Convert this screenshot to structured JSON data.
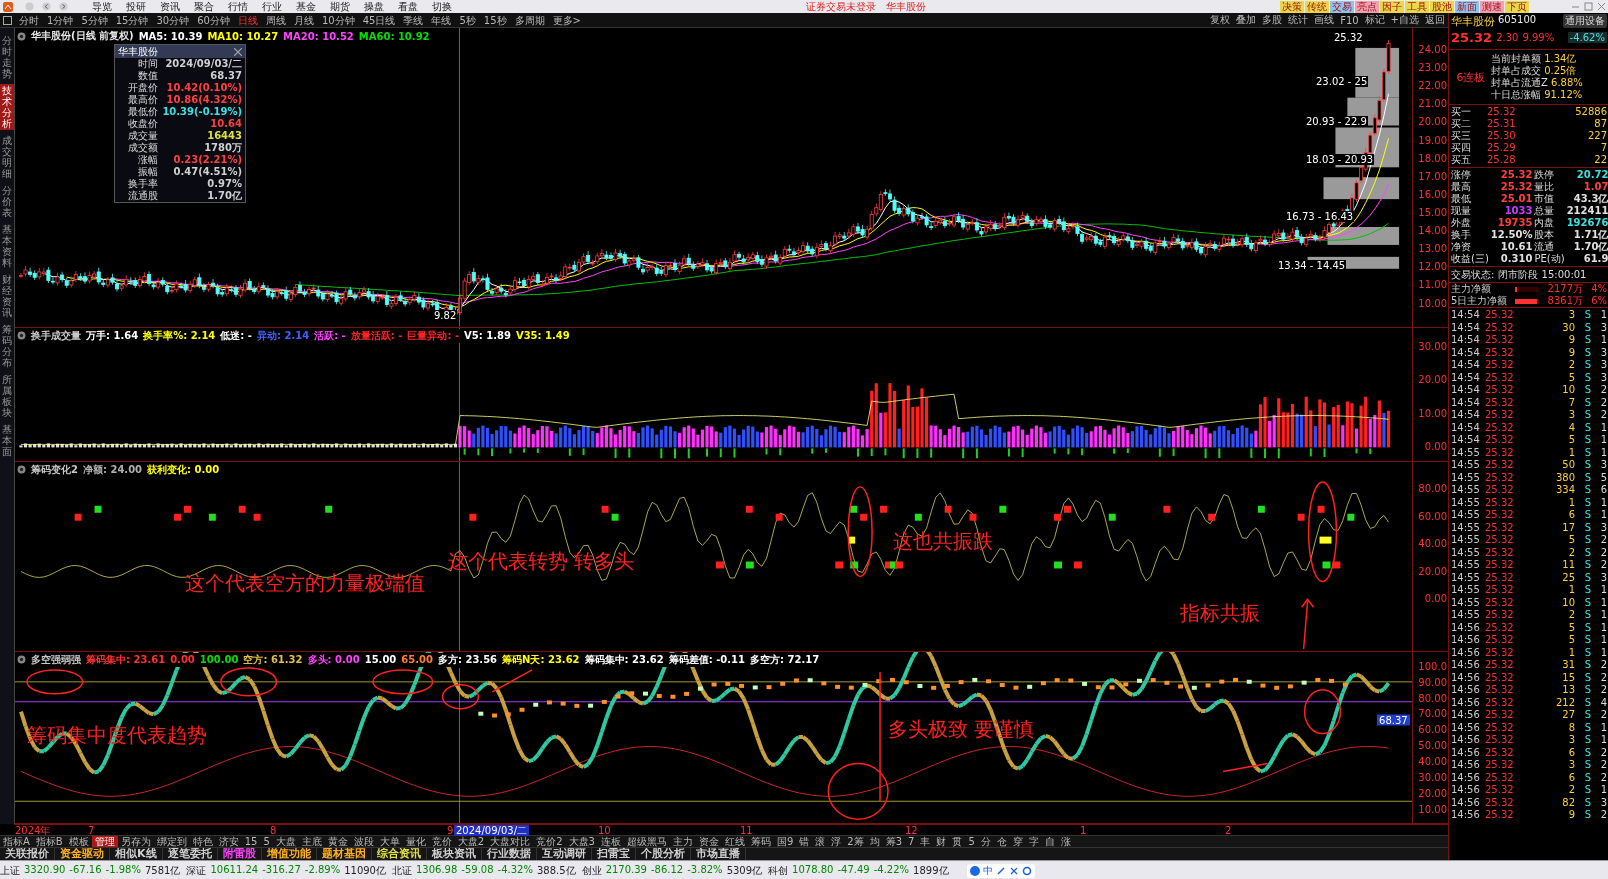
{
  "menu": [
    "导览",
    "投研",
    "资讯",
    "聚合",
    "行情",
    "行业",
    "基金",
    "期货",
    "操盘",
    "看盘",
    "切换"
  ],
  "login_notice": "证券交易未登录",
  "window_stock": "华丰股份",
  "top_buttons": [
    {
      "label": "决策",
      "color": "#e8d84a"
    },
    {
      "label": "传统",
      "color": "#e8d84a"
    },
    {
      "label": "交易",
      "color": "#8fc3f0"
    },
    {
      "label": "亮点",
      "color": "#f0a0b0"
    },
    {
      "label": "因子",
      "color": "#e8d84a"
    },
    {
      "label": "工具",
      "color": "#e8d84a"
    },
    {
      "label": "股池",
      "color": "#e8d84a"
    },
    {
      "label": "新面",
      "color": "#8fc3f0"
    },
    {
      "label": "测速",
      "color": "#f0a0b0"
    },
    {
      "label": "下页",
      "color": "#e8d84a"
    }
  ],
  "periods": [
    {
      "label": "分时",
      "selected": false
    },
    {
      "label": "1分钟",
      "selected": false
    },
    {
      "label": "5分钟",
      "selected": false
    },
    {
      "label": "15分钟",
      "selected": false
    },
    {
      "label": "30分钟",
      "selected": false
    },
    {
      "label": "60分钟",
      "selected": false
    },
    {
      "label": "日线",
      "selected": true
    },
    {
      "label": "周线",
      "selected": false
    },
    {
      "label": "月线",
      "selected": false
    },
    {
      "label": "10分钟",
      "selected": false
    },
    {
      "label": "45日线",
      "selected": false
    },
    {
      "label": "季线",
      "selected": false
    },
    {
      "label": "年线",
      "selected": false
    },
    {
      "label": "5秒",
      "selected": false
    },
    {
      "label": "15秒",
      "selected": false
    },
    {
      "label": "多周期",
      "selected": false
    },
    {
      "label": "更多>",
      "selected": false
    }
  ],
  "chart_tools": [
    "复权",
    "叠加",
    "多股",
    "统计",
    "画线",
    "F10",
    "标记",
    "+自选",
    "返回"
  ],
  "sidebar_tabs": [
    {
      "label": "分时走势",
      "selected": false
    },
    {
      "label": "技术分析",
      "selected": true
    },
    {
      "label": "成交明细",
      "selected": false
    },
    {
      "label": "分价表",
      "selected": false
    },
    {
      "label": "基本资料",
      "selected": false
    },
    {
      "label": "财经资讯",
      "selected": false
    },
    {
      "label": "筹码分布",
      "selected": false
    },
    {
      "label": "所属板块",
      "selected": false
    },
    {
      "label": "基本面",
      "selected": false
    }
  ],
  "price_pane": {
    "title": "华丰股份(日线 前复权)",
    "legend": [
      {
        "text": "MA5: 10.39",
        "color": "#ffffff"
      },
      {
        "text": "MA10: 10.27",
        "color": "#ffff00"
      },
      {
        "text": "MA20: 10.52",
        "color": "#ff44ff"
      },
      {
        "text": "MA60: 10.92",
        "color": "#00e000"
      }
    ],
    "yticks": [
      "24.00",
      "23.00",
      "22.00",
      "21.00",
      "20.00",
      "19.00",
      "18.00",
      "17.00",
      "16.00",
      "15.00",
      "14.00",
      "13.00",
      "12.00",
      "11.00",
      "10.00"
    ],
    "labels": [
      "25.32",
      "23.02 - 25",
      "20.93 - 22.9",
      "18.03 - 20.93",
      "16.73 - 16.43",
      "13.34 - 14.45",
      "9.82"
    ]
  },
  "info_box": {
    "title": "华丰股份",
    "rows": [
      {
        "label": "时间",
        "value": "2024/09/03/二",
        "color": "#d0d0d0"
      },
      {
        "label": "数值",
        "value": "68.37",
        "color": "#d0d0d0"
      },
      {
        "label": "开盘价",
        "value": "10.42(0.10%)",
        "color": "#ff4040"
      },
      {
        "label": "最高价",
        "value": "10.86(4.32%)",
        "color": "#ff4040"
      },
      {
        "label": "最低价",
        "value": "10.39(-0.19%)",
        "color": "#40e0e0"
      },
      {
        "label": "收盘价",
        "value": "10.64",
        "color": "#ff4040"
      },
      {
        "label": "成交量",
        "value": "16443",
        "color": "#e0e040"
      },
      {
        "label": "成交额",
        "value": "1780万",
        "color": "#d0d0d0"
      },
      {
        "label": "涨幅",
        "value": "0.23(2.21%)",
        "color": "#ff4040"
      },
      {
        "label": "振幅",
        "value": "0.47(4.51%)",
        "color": "#d0d0d0"
      },
      {
        "label": "换手率",
        "value": "0.97%",
        "color": "#d0d0d0"
      },
      {
        "label": "流通股",
        "value": "1.70亿",
        "color": "#d0d0d0"
      }
    ]
  },
  "volume_pane": {
    "legend": [
      {
        "text": "换手成交量",
        "color": "#c8c8c8"
      },
      {
        "text": "万手: 1.64",
        "color": "#ffffff"
      },
      {
        "text": "换手率%: 2.14",
        "color": "#ffff00"
      },
      {
        "text": "低迷: -",
        "color": "#ffffff"
      },
      {
        "text": "异动: 2.14",
        "color": "#4060ff"
      },
      {
        "text": "活跃: -",
        "color": "#ff40ff"
      },
      {
        "text": "放量活跃: -",
        "color": "#ff2020"
      },
      {
        "text": "巨量异动: -",
        "color": "#ff2020"
      },
      {
        "text": "V5: 1.89",
        "color": "#ffffff"
      },
      {
        "text": "V35: 1.49",
        "color": "#ffff00"
      }
    ],
    "yticks": [
      "30.00",
      "20.00",
      "10.00",
      "0.00"
    ]
  },
  "chip_pane": {
    "legend": [
      {
        "text": "筹码变化2",
        "color": "#c8c8c8"
      },
      {
        "text": "净额: 24.00",
        "color": "#b0b0b0"
      },
      {
        "text": "获利变化: 0.00",
        "color": "#ffff00"
      }
    ],
    "yticks": [
      "80.00",
      "60.00",
      "40.00",
      "20.00",
      "0.00"
    ],
    "notes": [
      "这个代表空方的力量极端值",
      "这个代表转势 转多头",
      "这也共振跌",
      "指标共振"
    ]
  },
  "strength_pane": {
    "legend": [
      {
        "text": "多空强弱强",
        "color": "#c8c8c8"
      },
      {
        "text": "筹码集中: 23.61",
        "color": "#ff3030"
      },
      {
        "text": "0.00",
        "color": "#ff3030"
      },
      {
        "text": "100.00",
        "color": "#00e000"
      },
      {
        "text": "空方: 61.32",
        "color": "#e0c040"
      },
      {
        "text": "多头: 0.00",
        "color": "#ff40ff"
      },
      {
        "text": "15.00",
        "color": "#ffffff"
      },
      {
        "text": "65.00",
        "color": "#ff8030"
      },
      {
        "text": "多方: 23.56",
        "color": "#ffffff"
      },
      {
        "text": "筹码N天: 23.62",
        "color": "#ffff00"
      },
      {
        "text": "筹码集中: 23.62",
        "color": "#ffffff"
      },
      {
        "text": "筹码差值: -0.11",
        "color": "#ffffff"
      },
      {
        "text": "多空方: 72.17",
        "color": "#ffffff"
      }
    ],
    "yticks": [
      "100.0",
      "90.00",
      "80.00",
      "70.00",
      "60.00",
      "50.00",
      "40.00",
      "30.00",
      "20.00",
      "10.00"
    ],
    "marker_value": "68.37",
    "notes": [
      "筹码集中度代表趋势",
      "多头极致 要谨慎"
    ]
  },
  "date_axis": {
    "labels": [
      "2024年",
      "7",
      "8",
      "9",
      "10",
      "11",
      "12",
      "1",
      "2"
    ],
    "cursor": "2024/09/03/二"
  },
  "quote": {
    "name": "华丰股份",
    "code": "605100",
    "sector": "通用设备",
    "sector_change": "-4.62%",
    "price": "25.32",
    "change": "2.30",
    "change_pct": "9.99%"
  },
  "limit_board": {
    "badge": "6连板",
    "lines": [
      {
        "label": "当前封单额",
        "value": "1.34亿"
      },
      {
        "label": "封单占成交",
        "value": "0.25倍"
      },
      {
        "label": "封单占流通Z",
        "value": "6.88%"
      },
      {
        "label": "十日总涨幅",
        "value": "91.12%"
      }
    ]
  },
  "order_book": [
    {
      "label": "买一",
      "price": "25.32",
      "volume": "52886"
    },
    {
      "label": "买二",
      "price": "25.31",
      "volume": "87"
    },
    {
      "label": "买三",
      "price": "25.30",
      "volume": "227"
    },
    {
      "label": "买四",
      "price": "25.29",
      "volume": "7"
    },
    {
      "label": "买五",
      "price": "25.28",
      "volume": "22"
    }
  ],
  "stats": [
    {
      "label": "涨停",
      "value": "25.32",
      "color": "#ff4040"
    },
    {
      "label": "跌停",
      "value": "20.72",
      "color": "#40e0e0"
    },
    {
      "label": "最高",
      "value": "25.32",
      "color": "#ff4040"
    },
    {
      "label": "量比",
      "value": "1.07",
      "color": "#ff4040"
    },
    {
      "label": "最低",
      "value": "25.01",
      "color": "#ff4040"
    },
    {
      "label": "市值",
      "value": "43.3亿",
      "color": "#e0e0e0"
    },
    {
      "label": "现量",
      "value": "1033",
      "color": "#c040ff"
    },
    {
      "label": "总量",
      "value": "212411",
      "color": "#e0e0e0"
    },
    {
      "label": "外盘",
      "value": "19735",
      "color": "#ff4040"
    },
    {
      "label": "内盘",
      "value": "192676",
      "color": "#40e0e0"
    },
    {
      "label": "换手",
      "value": "12.50%",
      "color": "#e0e0e0"
    },
    {
      "label": "股本",
      "value": "1.71亿",
      "color": "#e0e0e0"
    },
    {
      "label": "净资",
      "value": "10.61",
      "color": "#e0e0e0"
    },
    {
      "label": "流通",
      "value": "1.70亿",
      "color": "#e0e0e0"
    },
    {
      "label": "收益(三)",
      "value": "0.310",
      "color": "#e0e0e0"
    },
    {
      "label": "PE(动)",
      "value": "61.9",
      "color": "#e0e0e0"
    }
  ],
  "trade_status": {
    "label": "交易状态: 闭市阶段",
    "time": "15:00:01"
  },
  "flows": [
    {
      "label": "主力净额",
      "amount": "2177万",
      "pct": "4%",
      "level": 0.08
    },
    {
      "label": "5日主力净额",
      "amount": "8361万",
      "pct": "6%",
      "level": 0.9
    }
  ],
  "trades": [
    {
      "time": "14:54",
      "price": "25.32",
      "volume": "3",
      "side": "S",
      "count": "1"
    },
    {
      "time": "14:54",
      "price": "25.32",
      "volume": "30",
      "side": "S",
      "count": "3"
    },
    {
      "time": "14:54",
      "price": "25.32",
      "volume": "9",
      "side": "S",
      "count": "1"
    },
    {
      "time": "14:54",
      "price": "25.32",
      "volume": "9",
      "side": "S",
      "count": "3"
    },
    {
      "time": "14:54",
      "price": "25.32",
      "volume": "2",
      "side": "S",
      "count": "3"
    },
    {
      "time": "14:54",
      "price": "25.32",
      "volume": "5",
      "side": "S",
      "count": "3"
    },
    {
      "time": "14:54",
      "price": "25.32",
      "volume": "10",
      "side": "S",
      "count": "2"
    },
    {
      "time": "14:54",
      "price": "25.32",
      "volume": "7",
      "side": "S",
      "count": "2"
    },
    {
      "time": "14:54",
      "price": "25.32",
      "volume": "3",
      "side": "S",
      "count": "2"
    },
    {
      "time": "14:54",
      "price": "25.32",
      "volume": "4",
      "side": "S",
      "count": "1"
    },
    {
      "time": "14:54",
      "price": "25.32",
      "volume": "5",
      "side": "S",
      "count": "1"
    },
    {
      "time": "14:55",
      "price": "25.32",
      "volume": "1",
      "side": "S",
      "count": "1"
    },
    {
      "time": "14:55",
      "price": "25.32",
      "volume": "50",
      "side": "S",
      "count": "3"
    },
    {
      "time": "14:55",
      "price": "25.32",
      "volume": "380",
      "side": "S",
      "count": "5"
    },
    {
      "time": "14:55",
      "price": "25.32",
      "volume": "334",
      "side": "S",
      "count": "6"
    },
    {
      "time": "14:55",
      "price": "25.32",
      "volume": "1",
      "side": "S",
      "count": "1"
    },
    {
      "time": "14:55",
      "price": "25.32",
      "volume": "6",
      "side": "S",
      "count": "1"
    },
    {
      "time": "14:55",
      "price": "25.32",
      "volume": "17",
      "side": "S",
      "count": "3"
    },
    {
      "time": "14:55",
      "price": "25.32",
      "volume": "5",
      "side": "S",
      "count": "2"
    },
    {
      "time": "14:55",
      "price": "25.32",
      "volume": "2",
      "side": "S",
      "count": "2"
    },
    {
      "time": "14:55",
      "price": "25.32",
      "volume": "11",
      "side": "S",
      "count": "2"
    },
    {
      "time": "14:55",
      "price": "25.32",
      "volume": "25",
      "side": "S",
      "count": "3"
    },
    {
      "time": "14:55",
      "price": "25.32",
      "volume": "1",
      "side": "S",
      "count": "1"
    },
    {
      "time": "14:55",
      "price": "25.32",
      "volume": "10",
      "side": "S",
      "count": "1"
    },
    {
      "time": "14:55",
      "price": "25.32",
      "volume": "2",
      "side": "S",
      "count": "1"
    },
    {
      "time": "14:56",
      "price": "25.32",
      "volume": "5",
      "side": "S",
      "count": "1"
    },
    {
      "time": "14:56",
      "price": "25.32",
      "volume": "5",
      "side": "S",
      "count": "1"
    },
    {
      "time": "14:56",
      "price": "25.32",
      "volume": "1",
      "side": "S",
      "count": "1"
    },
    {
      "time": "14:56",
      "price": "25.32",
      "volume": "31",
      "side": "S",
      "count": "2"
    },
    {
      "time": "14:56",
      "price": "25.32",
      "volume": "15",
      "side": "S",
      "count": "2"
    },
    {
      "time": "14:56",
      "price": "25.32",
      "volume": "13",
      "side": "S",
      "count": "2"
    },
    {
      "time": "14:56",
      "price": "25.32",
      "volume": "212",
      "side": "S",
      "count": "4"
    },
    {
      "time": "14:56",
      "price": "25.32",
      "volume": "27",
      "side": "S",
      "count": "2"
    },
    {
      "time": "14:56",
      "price": "25.32",
      "volume": "8",
      "side": "S",
      "count": "1"
    },
    {
      "time": "14:56",
      "price": "25.32",
      "volume": "3",
      "side": "S",
      "count": "1"
    },
    {
      "time": "14:56",
      "price": "25.32",
      "volume": "6",
      "side": "S",
      "count": "2"
    },
    {
      "time": "14:56",
      "price": "25.32",
      "volume": "3",
      "side": "S",
      "count": "2"
    },
    {
      "time": "14:56",
      "price": "25.32",
      "volume": "6",
      "side": "S",
      "count": "2"
    },
    {
      "time": "14:56",
      "price": "25.32",
      "volume": "2",
      "side": "S",
      "count": "1"
    },
    {
      "time": "14:56",
      "price": "25.32",
      "volume": "82",
      "side": "S",
      "count": "3"
    },
    {
      "time": "14:56",
      "price": "25.32",
      "volume": "9",
      "side": "S",
      "count": "2"
    }
  ],
  "indicator_tabs": [
    {
      "label": "指标A",
      "selected": false
    },
    {
      "label": "指标B",
      "selected": false
    },
    {
      "label": "模板",
      "selected": false
    },
    {
      "label": "管理",
      "selected": true
    },
    {
      "label": "另存为",
      "selected": false
    },
    {
      "label": "绑定到",
      "selected": false
    },
    {
      "label": "特色",
      "selected": false
    },
    {
      "label": "济安",
      "selected": false
    },
    {
      "label": "15",
      "selected": false
    },
    {
      "label": "5",
      "selected": false
    },
    {
      "label": "大盘",
      "selected": false
    },
    {
      "label": "主底",
      "selected": false
    },
    {
      "label": "黄金",
      "selected": false
    },
    {
      "label": "波段",
      "selected": false
    },
    {
      "label": "大单",
      "selected": false
    },
    {
      "label": "量化",
      "selected": false
    },
    {
      "label": "竞价",
      "selected": false
    },
    {
      "label": "大盘2",
      "selected": false
    },
    {
      "label": "大盘对比",
      "selected": false
    },
    {
      "label": "竞价2",
      "selected": false
    },
    {
      "label": "大盘3",
      "selected": false
    },
    {
      "label": "连板",
      "selected": false
    },
    {
      "label": "超级黑马",
      "selected": false
    },
    {
      "label": "主力",
      "selected": false
    },
    {
      "label": "资金",
      "selected": false
    },
    {
      "label": "红线",
      "selected": false
    },
    {
      "label": "筹码",
      "selected": false
    },
    {
      "label": "国9",
      "selected": false
    },
    {
      "label": "错",
      "selected": false
    },
    {
      "label": "滚",
      "selected": false
    },
    {
      "label": "浮",
      "selected": false
    },
    {
      "label": "2筹",
      "selected": false
    },
    {
      "label": "均",
      "selected": false
    },
    {
      "label": "筹3",
      "selected": false
    },
    {
      "label": "7",
      "selected": false
    },
    {
      "label": "丰",
      "selected": false
    },
    {
      "label": "财",
      "selected": false
    },
    {
      "label": "贯",
      "selected": false
    },
    {
      "label": "5",
      "selected": false
    },
    {
      "label": "分",
      "selected": false
    },
    {
      "label": "仓",
      "selected": false
    },
    {
      "label": "穿",
      "selected": false
    },
    {
      "label": "字",
      "selected": false
    },
    {
      "label": "自",
      "selected": false
    },
    {
      "label": "涨",
      "selected": false
    }
  ],
  "feature_tabs": [
    {
      "label": "关联报价",
      "kind": "plain"
    },
    {
      "label": "资金驱动",
      "kind": "feature"
    },
    {
      "label": "相似K线",
      "kind": "plain"
    },
    {
      "label": "逐笔委托",
      "kind": "plain"
    },
    {
      "label": "附雷股",
      "kind": "alert"
    },
    {
      "label": "增值功能",
      "kind": "feature"
    },
    {
      "label": "题材基因",
      "kind": "feature"
    },
    {
      "label": "综合资讯",
      "kind": "news"
    },
    {
      "label": "板块资讯",
      "kind": "plain"
    },
    {
      "label": "行业数据",
      "kind": "plain"
    },
    {
      "label": "互动调研",
      "kind": "plain"
    },
    {
      "label": "扫雷宝",
      "kind": "plain"
    },
    {
      "label": "个股分析",
      "kind": "plain"
    },
    {
      "label": "市场直播",
      "kind": "plain"
    }
  ],
  "indices": [
    {
      "name": "上证",
      "value": "3320.90",
      "change": "-67.16",
      "pct": "-1.98%",
      "amount": "7581亿"
    },
    {
      "name": "深证",
      "value": "10611.24",
      "change": "-316.27",
      "pct": "-2.89%",
      "amount": "11090亿"
    },
    {
      "name": "北证",
      "value": "1306.98",
      "change": "-59.08",
      "pct": "-4.32%",
      "amount": "388.5亿"
    },
    {
      "name": "创业",
      "value": "2170.39",
      "change": "-86.12",
      "pct": "-3.82%",
      "amount": "5309亿"
    },
    {
      "name": "科创",
      "value": "1078.80",
      "change": "-47.49",
      "pct": "-4.22%",
      "amount": "1899亿"
    }
  ],
  "ime_tools": [
    "中"
  ]
}
